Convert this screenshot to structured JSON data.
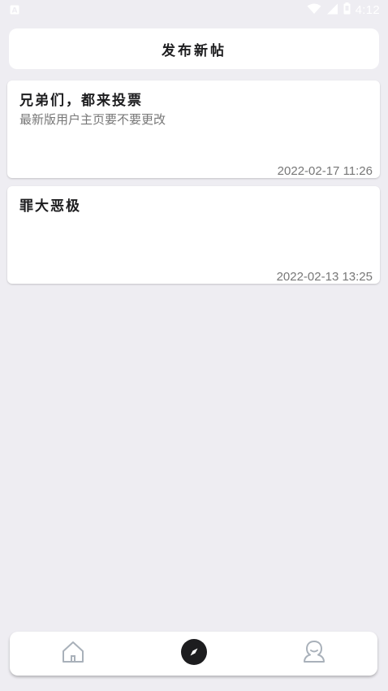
{
  "status_bar": {
    "time": "4:12",
    "icons": [
      "notification-a-icon",
      "wifi-icon",
      "signal-icon",
      "battery-icon"
    ]
  },
  "publish_button": {
    "label": "发布新帖"
  },
  "posts": [
    {
      "title": "兄弟们，都来投票",
      "subtitle": "最新版用户主页要不要更改",
      "time": "2022-02-17 11:26"
    },
    {
      "title": "罪大恶极",
      "subtitle": "",
      "time": "2022-02-13 13:25"
    }
  ],
  "bottom_nav": {
    "items": [
      {
        "icon": "home-icon",
        "active": false
      },
      {
        "icon": "compass-icon",
        "active": true
      },
      {
        "icon": "profile-icon",
        "active": false
      }
    ]
  },
  "colors": {
    "background": "#eeedf2",
    "card": "#ffffff",
    "text_primary": "#1d1d1f",
    "text_secondary": "#777777",
    "icon_inactive": "#a9b1ba",
    "icon_active": "#1d1d1f"
  }
}
